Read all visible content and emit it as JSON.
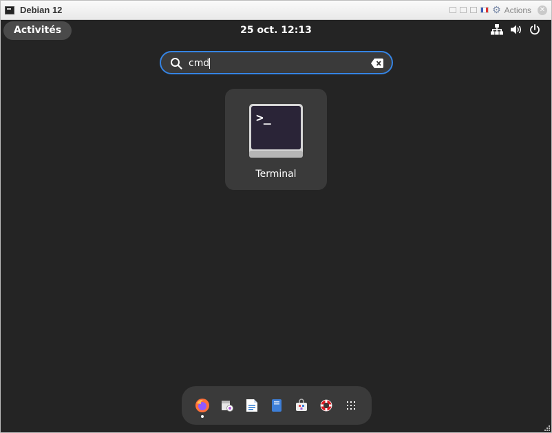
{
  "vm_window": {
    "title": "Debian 12",
    "actions_label": "Actions"
  },
  "topbar": {
    "activities_label": "Activités",
    "clock": "25 oct.  12:13"
  },
  "search": {
    "value": "cmd"
  },
  "results": [
    {
      "label": "Terminal",
      "icon": "terminal-icon"
    }
  ],
  "dash": {
    "items": [
      {
        "name": "firefox-icon",
        "running": true
      },
      {
        "name": "evolution-icon",
        "running": false
      },
      {
        "name": "writer-icon",
        "running": false
      },
      {
        "name": "notes-icon",
        "running": false
      },
      {
        "name": "software-icon",
        "running": false
      },
      {
        "name": "help-icon",
        "running": false
      },
      {
        "name": "show-apps-icon",
        "running": false
      }
    ]
  },
  "colors": {
    "background": "#242424",
    "accent": "#3584e4",
    "panel": "#3a3a3a"
  }
}
